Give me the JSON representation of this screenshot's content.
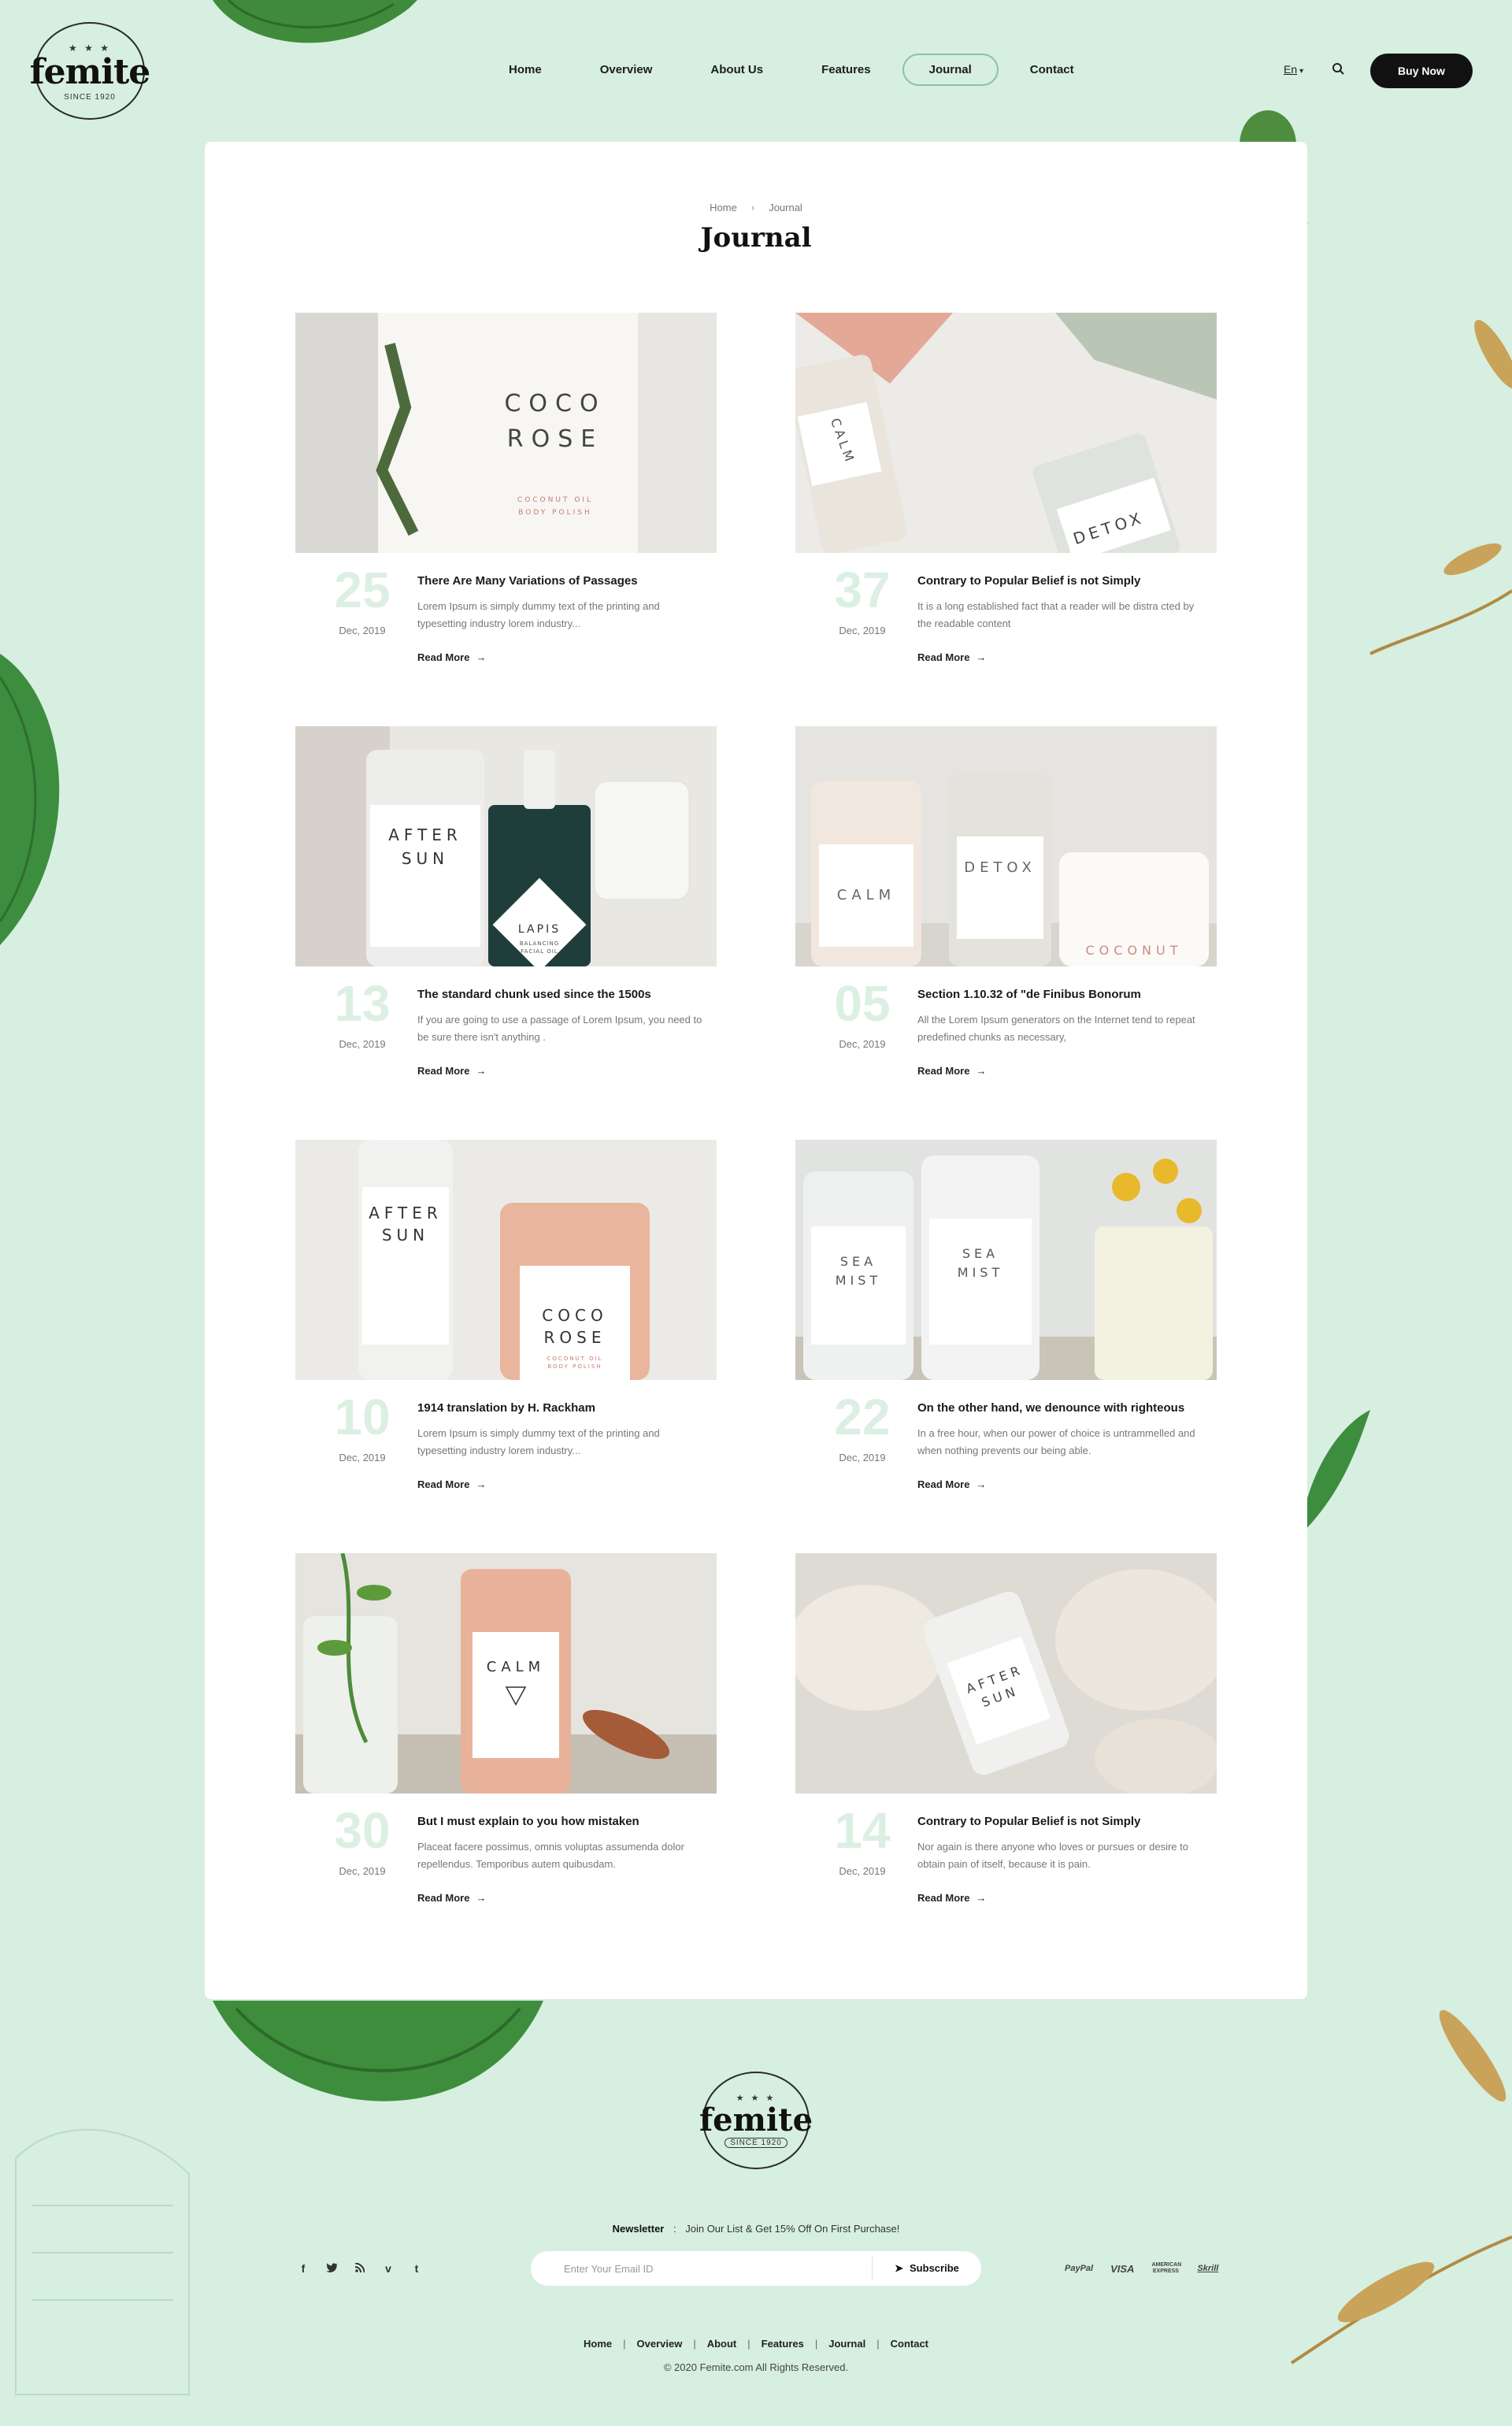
{
  "brand": {
    "name": "femite",
    "since": "SINCE 1920",
    "stars": "★ ★ ★"
  },
  "nav": {
    "items": [
      "Home",
      "Overview",
      "About Us",
      "Features",
      "Journal",
      "Contact"
    ],
    "active": "Journal"
  },
  "header": {
    "lang": "En",
    "buy_label": "Buy Now"
  },
  "breadcrumb": {
    "home": "Home",
    "sep": "›",
    "current": "Journal"
  },
  "page_title": "Journal",
  "posts": [
    {
      "day": "25",
      "date": "Dec, 2019",
      "title": "There Are Many Variations of Passages",
      "excerpt": "Lorem Ipsum is simply dummy text of the printing and typesetting industry lorem industry...",
      "more": "Read More"
    },
    {
      "day": "37",
      "date": "Dec, 2019",
      "title": "Contrary to Popular Belief is not Simply",
      "excerpt": "It is a long established fact that a reader will be distra cted by the readable content",
      "more": "Read More"
    },
    {
      "day": "13",
      "date": "Dec, 2019",
      "title": "The standard chunk used since the 1500s",
      "excerpt": "If you are going to use a passage of Lorem Ipsum, you need to be sure there isn't anything .",
      "more": "Read More"
    },
    {
      "day": "05",
      "date": "Dec, 2019",
      "title": "Section 1.10.32 of \"de Finibus Bonorum",
      "excerpt": "All the Lorem Ipsum generators on the Internet tend to repeat predefined chunks as necessary,",
      "more": "Read More"
    },
    {
      "day": "10",
      "date": "Dec, 2019",
      "title": "1914 translation by H. Rackham",
      "excerpt": "Lorem Ipsum is simply dummy text of the printing and typesetting industry lorem industry...",
      "more": "Read More"
    },
    {
      "day": "22",
      "date": "Dec, 2019",
      "title": "On the other hand, we denounce with righteous",
      "excerpt": "In a free hour, when our power of choice is untrammelled and when nothing prevents our being able.",
      "more": "Read More"
    },
    {
      "day": "30",
      "date": "Dec, 2019",
      "title": "But I must explain to you how mistaken",
      "excerpt": "Placeat facere possimus, omnis voluptas assumenda dolor repellendus. Temporibus autem quibusdam.",
      "more": "Read More"
    },
    {
      "day": "14",
      "date": "Dec, 2019",
      "title": "Contrary to Popular Belief is not Simply",
      "excerpt": "Nor again is there anyone who loves or pursues or desire to obtain pain of itself, because it is pain.",
      "more": "Read More"
    }
  ],
  "thumbs": {
    "t1": [
      "COCO",
      "ROSE",
      "COCONUT OIL",
      "BODY POLISH"
    ],
    "t2": [
      "CALM",
      "DETOX"
    ],
    "t3": [
      "AFTER",
      "SUN",
      "LAPIS",
      "BALANCING",
      "FACIAL OIL"
    ],
    "t4": [
      "CALM",
      "DETOX",
      "COCONUT"
    ],
    "t5": [
      "AFTER",
      "SUN",
      "COCO",
      "ROSE",
      "COCONUT OIL",
      "BODY POLISH"
    ],
    "t6": [
      "SEA",
      "MIST",
      "SEA",
      "MIST"
    ],
    "t7": [
      "CALM"
    ],
    "t8": [
      "AFTER",
      "SUN"
    ]
  },
  "footer": {
    "newsletter_title": "Newsletter",
    "newsletter_text": "Join Our List & Get 15% Off On First Purchase!",
    "email_placeholder": "Enter Your Email ID",
    "subscribe_label": "Subscribe",
    "social": [
      "f",
      "t",
      "rss",
      "v",
      "t"
    ],
    "payments": [
      "PayPal",
      "VISA",
      "AMERICAN EXPRESS",
      "Skrill"
    ],
    "links": [
      "Home",
      "Overview",
      "About",
      "Features",
      "Journal",
      "Contact"
    ],
    "copyright": "© 2020 Femite.com All Rights Reserved."
  },
  "colors": {
    "background": "#d6efe0",
    "accent": "#8fbfa4",
    "day_number": "#dcefe3",
    "button": "#111111"
  },
  "icons": {
    "search": "search-icon",
    "arrow": "arrow-right-icon",
    "send": "paper-plane-icon"
  }
}
